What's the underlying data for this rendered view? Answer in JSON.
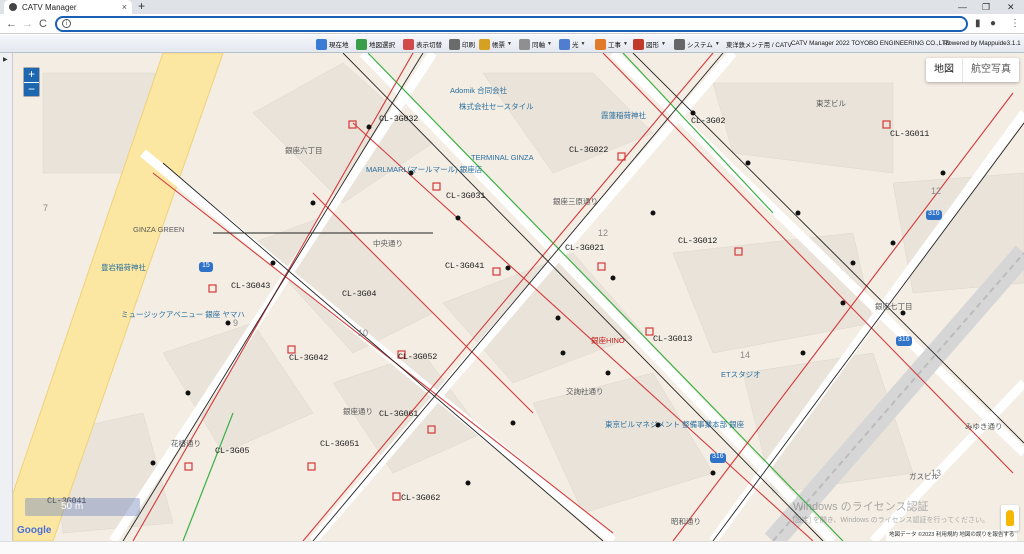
{
  "browser": {
    "tab_title": "CATV Manager",
    "tab_close": "×",
    "new_tab": "+",
    "url_value": "",
    "win_min": "—",
    "win_max": "❐",
    "win_close": "✕",
    "back": "←",
    "forward": "→",
    "reload": "C",
    "menu": "⋮"
  },
  "toolbar": {
    "items": [
      {
        "label": "現在地",
        "icon": "crosshair-icon",
        "color": "#3b7bd6",
        "dd": ""
      },
      {
        "label": "地図選択",
        "icon": "map-select-icon",
        "color": "#3a9d4a",
        "dd": ""
      },
      {
        "label": "表示切替",
        "icon": "layers-icon",
        "color": "#d24b4b",
        "dd": ""
      },
      {
        "label": "印刷",
        "icon": "printer-icon",
        "color": "#6b6b6b",
        "dd": ""
      },
      {
        "label": "帳票",
        "icon": "report-icon",
        "color": "#d6a020",
        "dd": "▼"
      },
      {
        "label": "同軸",
        "icon": "coax-icon",
        "color": "#8f8f8f",
        "dd": "▼"
      },
      {
        "label": "光",
        "icon": "optical-icon",
        "color": "#4f7ed0",
        "dd": "▼"
      },
      {
        "label": "工事",
        "icon": "worker-icon",
        "color": "#e07b2a",
        "dd": "▼"
      },
      {
        "label": "図形",
        "icon": "shape-icon",
        "color": "#c0392b",
        "dd": "▼"
      },
      {
        "label": "システム",
        "icon": "house-icon",
        "color": "#666666",
        "dd": "▼"
      }
    ],
    "company": "東洋鉄メンテ用 / CATV",
    "product": "CATV Manager 2022 TOYOBO ENGINEERING CO.,LTD",
    "powered": "Powered by Mappuide3.1.1"
  },
  "map": {
    "zoom_in": "+",
    "zoom_out": "−",
    "type_map": "地図",
    "type_sat": "航空写真",
    "scale": "50 m",
    "google": "Google",
    "attribution": "地図データ ©2023    利用規約    地図の誤りを報告する",
    "watermark_1": "Windows のライセンス認証",
    "watermark_2": "[設定] を開き、Windows のライセンス認証を行ってください。",
    "cable_labels": [
      "CL-3G032",
      "CL-3G022",
      "CL-3G02",
      "CL-3G011",
      "CL-3G031",
      "CL-3G021",
      "CL-3G012",
      "CL-3G041",
      "CL-3G043",
      "CL-3G04",
      "CL-3G042",
      "CL-3G052",
      "CL-3G013",
      "CL-3G061",
      "CL-3G051",
      "CL-3G05",
      "CL-3G062",
      "CL-3G041"
    ],
    "pois": [
      {
        "label": "Adomik 合同会社",
        "red": false
      },
      {
        "label": "株式会社セースタイル",
        "red": false
      },
      {
        "label": "霞蓮稲荷神社",
        "red": false
      },
      {
        "label": "TERMINAL GINZA",
        "red": false
      },
      {
        "label": "MARLMARL(マールマール) 銀座店",
        "red": false
      },
      {
        "label": "豊岩稲荷神社",
        "red": false
      },
      {
        "label": "ミュージックアベニュー 銀座 ヤマハ",
        "red": false
      },
      {
        "label": "銀座HINO",
        "red": true
      },
      {
        "label": "ETスタジオ",
        "red": false
      },
      {
        "label": "東京ビルマネジメント 整備事業本部 銀座",
        "red": false
      }
    ],
    "places": [
      "銀座六丁目",
      "銀座七丁目",
      "GINZA GREEN",
      "中央通り",
      "みゆき通り",
      "昭和通り",
      "銀座三原通り",
      "交詢社通り",
      "花椿通り",
      "銀座通り",
      "東芝ビル",
      "ガスビル"
    ],
    "blocks": [
      "7",
      "9",
      "10",
      "12",
      "14",
      "12",
      "13"
    ],
    "route_badges": [
      "15",
      "316",
      "316",
      "316",
      "15",
      "15"
    ]
  },
  "statusbar": {
    "left": "",
    "right": ""
  }
}
